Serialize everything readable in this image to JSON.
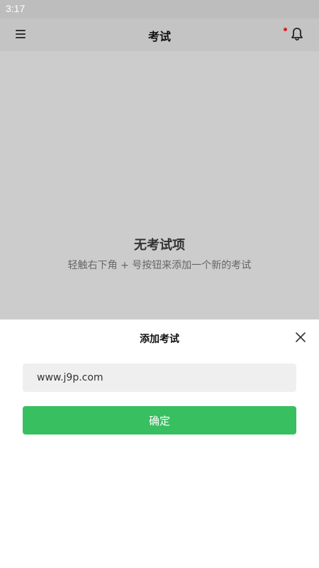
{
  "status_bar": {
    "time": "3:17"
  },
  "app_bar": {
    "title": "考试",
    "notification_dot_color": "#e02020"
  },
  "empty_state": {
    "title": "无考试项",
    "hint": "轻触右下角 + 号按钮来添加一个新的考试"
  },
  "add_sheet": {
    "title": "添加考试",
    "input_value": "www.j9p.com",
    "confirm_label": "确定",
    "confirm_color": "#38bf60"
  }
}
